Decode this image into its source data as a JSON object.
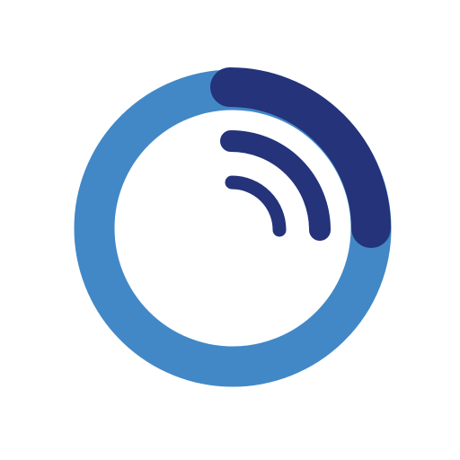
{
  "logo": {
    "icon": "signal-ring-icon",
    "colors": {
      "background": "#ffffff",
      "ring": "#4288c7",
      "accent": "#24337a"
    },
    "progress_fraction": 0.25
  }
}
